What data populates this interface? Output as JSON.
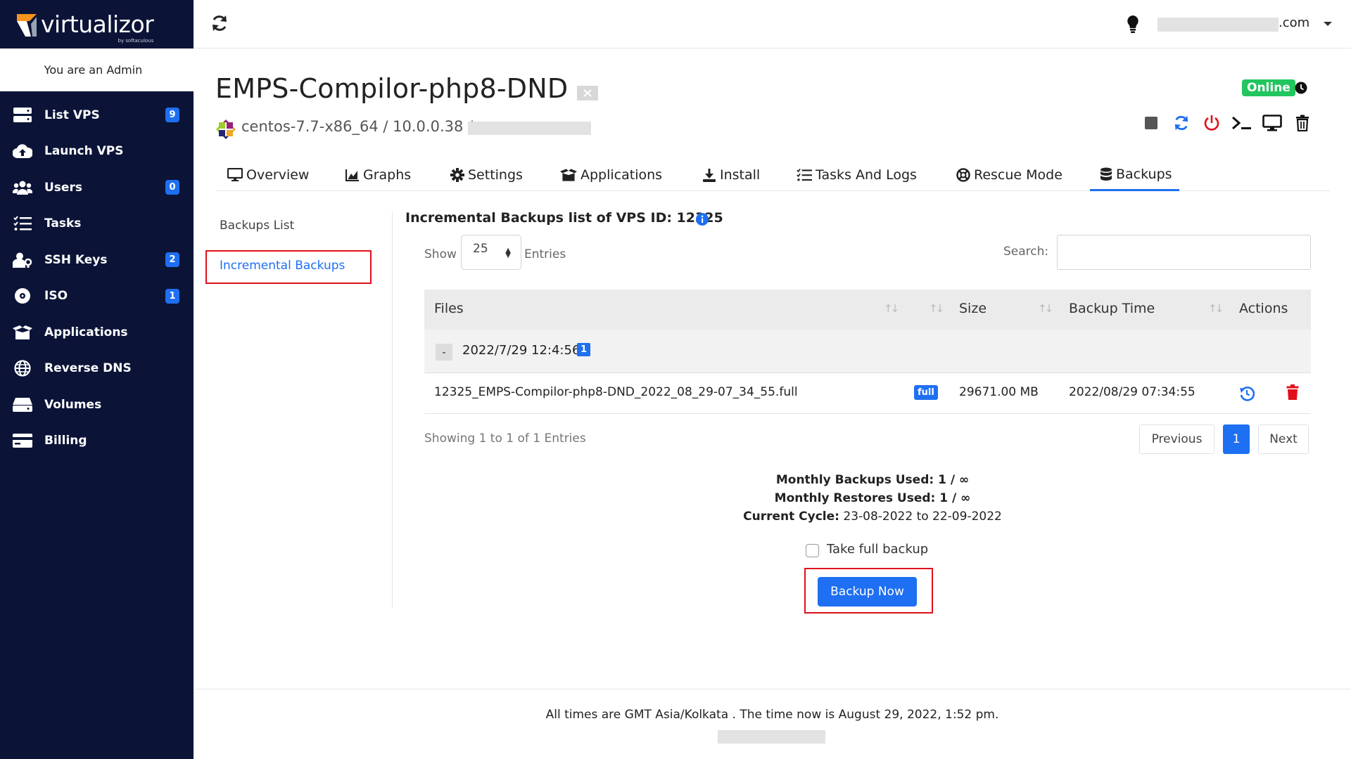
{
  "brand": {
    "name": "virtualizor",
    "sub": "by softaculous"
  },
  "sidebar": {
    "admin_text": "You are an Admin",
    "items": [
      {
        "label": "List VPS",
        "icon": "server-icon",
        "badge": "9"
      },
      {
        "label": "Launch VPS",
        "icon": "cloud-upload-icon",
        "badge": ""
      },
      {
        "label": "Users",
        "icon": "users-icon",
        "badge": "0"
      },
      {
        "label": "Tasks",
        "icon": "tasks-icon",
        "badge": ""
      },
      {
        "label": "SSH Keys",
        "icon": "user-key-icon",
        "badge": "2"
      },
      {
        "label": "ISO",
        "icon": "disc-icon",
        "badge": "1"
      },
      {
        "label": "Applications",
        "icon": "box-open-icon",
        "badge": ""
      },
      {
        "label": "Reverse DNS",
        "icon": "globe-icon",
        "badge": ""
      },
      {
        "label": "Volumes",
        "icon": "hdd-icon",
        "badge": ""
      },
      {
        "label": "Billing",
        "icon": "credit-card-icon",
        "badge": ""
      }
    ]
  },
  "topbar": {
    "user_domain": ".com"
  },
  "vps": {
    "title": "EMPS-Compilor-php8-DND",
    "status": "Online",
    "os_ip": "centos-7.7-x86_64 / 10.0.0.38 /"
  },
  "tabs": [
    {
      "label": "Overview",
      "icon": "monitor-icon"
    },
    {
      "label": "Graphs",
      "icon": "chart-icon"
    },
    {
      "label": "Settings",
      "icon": "gear-icon"
    },
    {
      "label": "Applications",
      "icon": "box-open-icon"
    },
    {
      "label": "Install",
      "icon": "download-icon"
    },
    {
      "label": "Tasks And Logs",
      "icon": "list-check-icon"
    },
    {
      "label": "Rescue Mode",
      "icon": "life-ring-icon"
    },
    {
      "label": "Backups",
      "icon": "database-icon"
    }
  ],
  "submenu": {
    "backups_list": "Backups List",
    "incremental": "Incremental Backups"
  },
  "main": {
    "title": "Incremental Backups list of VPS ID: 12325",
    "show_label": "Show",
    "show_value": "25",
    "entries_label": "Entries",
    "search_label": "Search:",
    "search_value": "",
    "columns": [
      "Files",
      "Size",
      "Backup Time",
      "Actions"
    ],
    "group": {
      "date": "2022/7/29 12:4:56",
      "count": "1",
      "collapse": "-"
    },
    "row": {
      "file": "12325_EMPS-Compilor-php8-DND_2022_08_29-07_34_55.full",
      "type": "full",
      "size": "29671.00 MB",
      "time": "2022/08/29 07:34:55"
    },
    "showing": "Showing 1 to 1 of 1 Entries",
    "pager": {
      "prev": "Previous",
      "current": "1",
      "next": "Next"
    },
    "stats": {
      "monthly_backups_label": "Monthly Backups Used:",
      "monthly_backups_value": " 1 / ∞",
      "monthly_restores_label": "Monthly Restores Used:",
      "monthly_restores_value": " 1 / ∞",
      "cycle_label": "Current Cycle:",
      "cycle_value": " 23-08-2022 to 22-09-2022"
    },
    "full_backup_label": "Take full backup",
    "backup_button": "Backup Now"
  },
  "footer": {
    "text": "All times are GMT Asia/Kolkata . The time now is August 29, 2022, 1:52 pm."
  },
  "colors": {
    "sidebar_bg": "#0b1437",
    "accent": "#1e6ff2",
    "online": "#22c55e",
    "danger": "#e0101a"
  }
}
